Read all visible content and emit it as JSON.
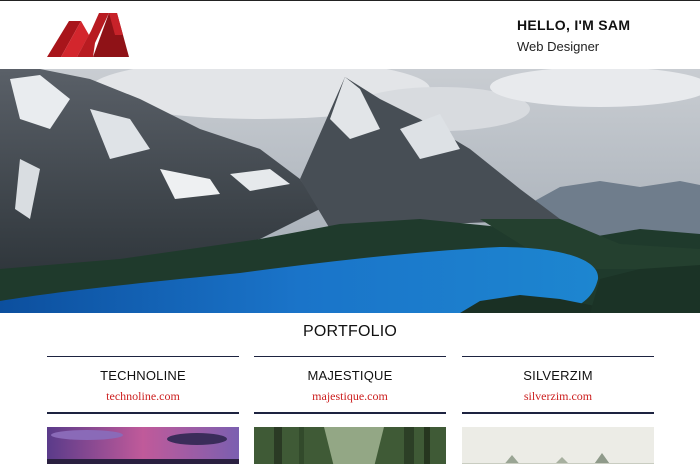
{
  "brand": {
    "logo_icon": "mountain-m-logo",
    "accent_color": "#c41e24"
  },
  "header": {
    "greeting": "HELLO, I'M SAM",
    "role": "Web Designer"
  },
  "hero": {
    "image": "mountain-lake-photo"
  },
  "portfolio": {
    "title": "PORTFOLIO",
    "items": [
      {
        "name": "TECHNOLINE",
        "link": "technoline.com",
        "thumb": "sunset-sky-photo"
      },
      {
        "name": "MAJESTIQUE",
        "link": "majestique.com",
        "thumb": "forest-sunbeams-photo"
      },
      {
        "name": "SILVERZIM",
        "link": "silverzim.com",
        "thumb": "misty-trees-photo"
      }
    ]
  }
}
